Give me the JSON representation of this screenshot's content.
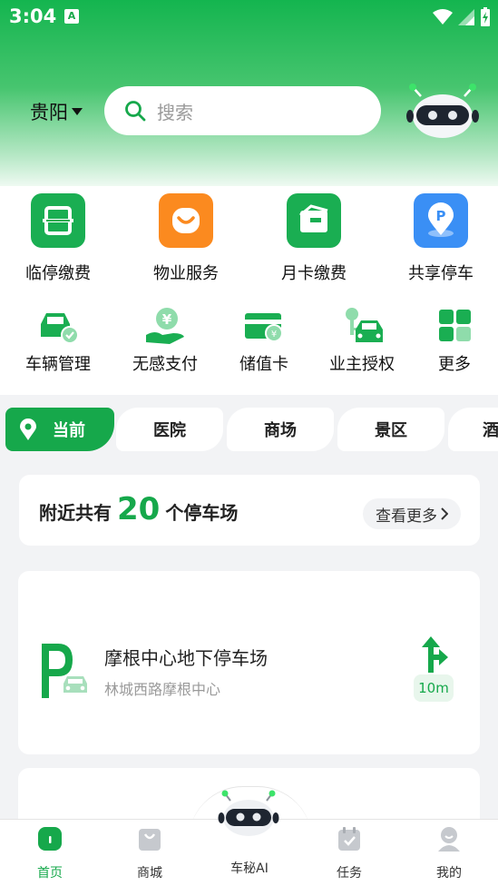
{
  "status_bar": {
    "time": "3:04",
    "notif_letter": "A"
  },
  "header": {
    "city": "贵阳",
    "search_placeholder": "搜索"
  },
  "services_primary": [
    {
      "label": "临停缴费",
      "icon": "temp-parking-icon",
      "color": "#1aae52"
    },
    {
      "label": "物业服务",
      "icon": "property-service-icon",
      "color": "#fb8a1f"
    },
    {
      "label": "月卡缴费",
      "icon": "monthly-card-icon",
      "color": "#1aae52"
    },
    {
      "label": "共享停车",
      "icon": "shared-parking-icon",
      "color": "#3a8ff5"
    }
  ],
  "services_secondary": [
    {
      "label": "车辆管理",
      "icon": "vehicle-manage-icon"
    },
    {
      "label": "无感支付",
      "icon": "seamless-pay-icon"
    },
    {
      "label": "储值卡",
      "icon": "stored-value-card-icon"
    },
    {
      "label": "业主授权",
      "icon": "owner-auth-icon"
    },
    {
      "label": "更多",
      "icon": "more-grid-icon"
    }
  ],
  "category_tabs": [
    {
      "label": "当前",
      "active": true
    },
    {
      "label": "医院",
      "active": false
    },
    {
      "label": "商场",
      "active": false
    },
    {
      "label": "景区",
      "active": false
    },
    {
      "label": "酒",
      "active": false
    }
  ],
  "nearby": {
    "prefix": "附近共有",
    "count": "20",
    "suffix": "个停车场",
    "more_label": "查看更多"
  },
  "parking_lot": {
    "name": "摩根中心地下停车场",
    "address": "林城西路摩根中心",
    "distance": "10m"
  },
  "bottom_nav": [
    {
      "label": "首页",
      "icon": "home-icon",
      "active": true
    },
    {
      "label": "商城",
      "icon": "shop-bag-icon",
      "active": false
    },
    {
      "label": "车秘AI",
      "icon": "robot-ai-icon",
      "active": false
    },
    {
      "label": "任务",
      "icon": "task-calendar-icon",
      "active": false
    },
    {
      "label": "我的",
      "icon": "profile-icon",
      "active": false
    }
  ],
  "colors": {
    "brand_green": "#16a84b",
    "orange": "#fb8a1f",
    "blue": "#3a8ff5"
  }
}
